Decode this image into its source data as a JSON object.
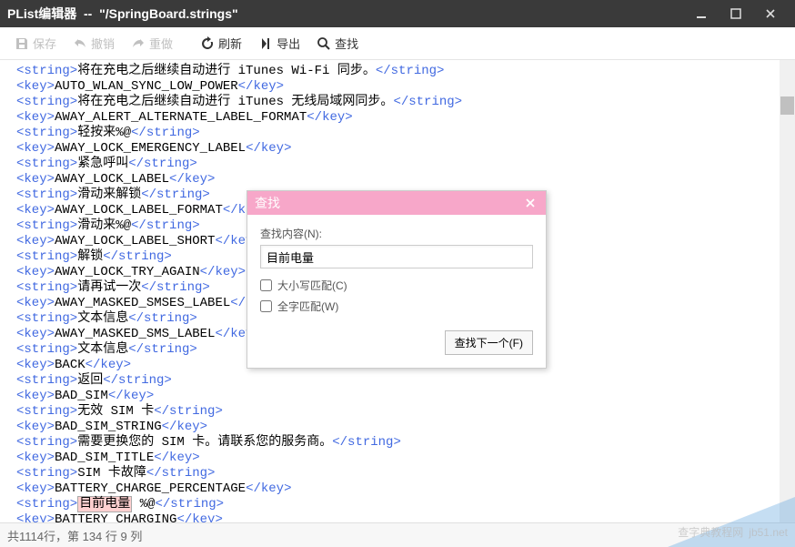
{
  "titlebar": {
    "appName": "PList编辑器",
    "separator": "--",
    "filePath": "\"/SpringBoard.strings\""
  },
  "toolbar": {
    "save": "保存",
    "undo": "撤销",
    "redo": "重做",
    "refresh": "刷新",
    "export": "导出",
    "find": "查找"
  },
  "editor": {
    "lines": [
      {
        "pre": "<string>",
        "txt": "将在充电之后继续自动进行 iTunes Wi-Fi 同步。",
        "post": "</string>"
      },
      {
        "pre": "<key>",
        "txt": "AUTO_WLAN_SYNC_LOW_POWER",
        "post": "</key>"
      },
      {
        "pre": "<string>",
        "txt": "将在充电之后继续自动进行 iTunes 无线局域网同步。",
        "post": "</string>"
      },
      {
        "pre": "<key>",
        "txt": "AWAY_ALERT_ALTERNATE_LABEL_FORMAT",
        "post": "</key>"
      },
      {
        "pre": "<string>",
        "txt": "轻按来%@",
        "post": "</string>"
      },
      {
        "pre": "<key>",
        "txt": "AWAY_LOCK_EMERGENCY_LABEL",
        "post": "</key>"
      },
      {
        "pre": "<string>",
        "txt": "紧急呼叫",
        "post": "</string>"
      },
      {
        "pre": "<key>",
        "txt": "AWAY_LOCK_LABEL",
        "post": "</key>"
      },
      {
        "pre": "<string>",
        "txt": "滑动来解锁",
        "post": "</string>"
      },
      {
        "pre": "<key>",
        "txt": "AWAY_LOCK_LABEL_FORMAT",
        "post": "</key>"
      },
      {
        "pre": "<string>",
        "txt": "滑动来%@",
        "post": "</string>"
      },
      {
        "pre": "<key>",
        "txt": "AWAY_LOCK_LABEL_SHORT",
        "post": "</key>"
      },
      {
        "pre": "<string>",
        "txt": "解锁",
        "post": "</string>"
      },
      {
        "pre": "<key>",
        "txt": "AWAY_LOCK_TRY_AGAIN",
        "post": "</key>"
      },
      {
        "pre": "<string>",
        "txt": "请再试一次",
        "post": "</string>"
      },
      {
        "pre": "<key>",
        "txt": "AWAY_MASKED_SMSES_LABEL",
        "post": "</key>"
      },
      {
        "pre": "<string>",
        "txt": "文本信息",
        "post": "</string>"
      },
      {
        "pre": "<key>",
        "txt": "AWAY_MASKED_SMS_LABEL",
        "post": "</key>"
      },
      {
        "pre": "<string>",
        "txt": "文本信息",
        "post": "</string>"
      },
      {
        "pre": "<key>",
        "txt": "BACK",
        "post": "</key>"
      },
      {
        "pre": "<string>",
        "txt": "返回",
        "post": "</string>"
      },
      {
        "pre": "<key>",
        "txt": "BAD_SIM",
        "post": "</key>"
      },
      {
        "pre": "<string>",
        "txt": "无效 SIM 卡",
        "post": "</string>"
      },
      {
        "pre": "<key>",
        "txt": "BAD_SIM_STRING",
        "post": "</key>"
      },
      {
        "pre": "<string>",
        "txt": "需要更换您的 SIM 卡。请联系您的服务商。",
        "post": "</string>"
      },
      {
        "pre": "<key>",
        "txt": "BAD_SIM_TITLE",
        "post": "</key>"
      },
      {
        "pre": "<string>",
        "txt": "SIM 卡故障",
        "post": "</string>"
      },
      {
        "pre": "<key>",
        "txt": "BATTERY_CHARGE_PERCENTAGE",
        "post": "</key>"
      },
      {
        "pre": "<string>",
        "txt": "目前电量",
        "txtExtra": " %@",
        "post": "</string>",
        "highlight": true
      },
      {
        "pre": "<key>",
        "txt": "BATTERY_CHARGING",
        "post": "</key>"
      }
    ]
  },
  "findDialog": {
    "title": "查找",
    "inputLabel": "查找内容(N):",
    "inputValue": "目前电量",
    "caseMatch": "大小写匹配(C)",
    "wholeWord": "全字匹配(W)",
    "findNext": "查找下一个(F)"
  },
  "status": {
    "text": "共1114行，第 134 行 9 列"
  },
  "watermark": {
    "site1": "jb51.net",
    "site2": "查字典教程网"
  }
}
